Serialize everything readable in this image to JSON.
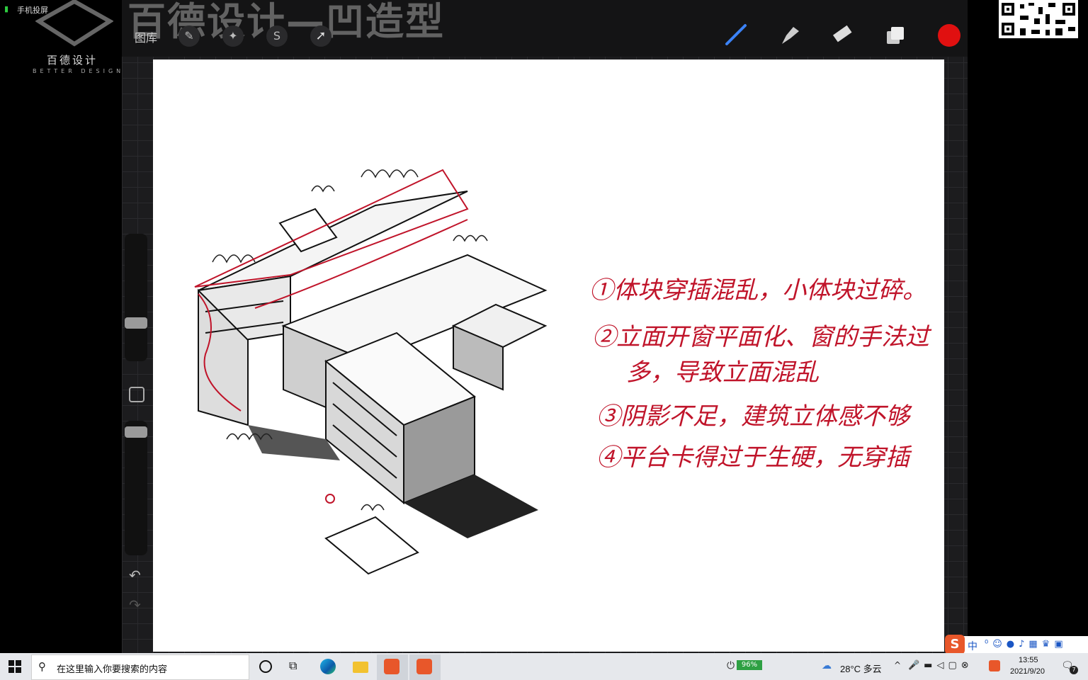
{
  "status": {
    "signal": "手机投屏"
  },
  "logo": {
    "chinese": "百德设计",
    "english": "BETTER DESIGN"
  },
  "header": {
    "banner": "百德设计—凹造型",
    "gallery_label": "图库"
  },
  "tools": {
    "brush": "brush-icon",
    "smudge": "smudge-icon",
    "eraser": "eraser-icon",
    "layers": "layers-icon",
    "color": "#e01010"
  },
  "canvas": {
    "notes": [
      "①体块穿插混乱，小体块过碎。",
      "②立面开窗平面化、窗的手法过",
      "多，导致立面混乱",
      "③阴影不足，建筑立体感不够",
      "④平台卡得过于生硬，无穿插"
    ]
  },
  "taskbar": {
    "search_placeholder": "在这里输入你要搜索的内容",
    "battery": "96%",
    "weather": "28°C 多云",
    "time": "13:55",
    "date": "2021/9/20",
    "notification_count": "7"
  },
  "ime": {
    "mode": "中"
  }
}
